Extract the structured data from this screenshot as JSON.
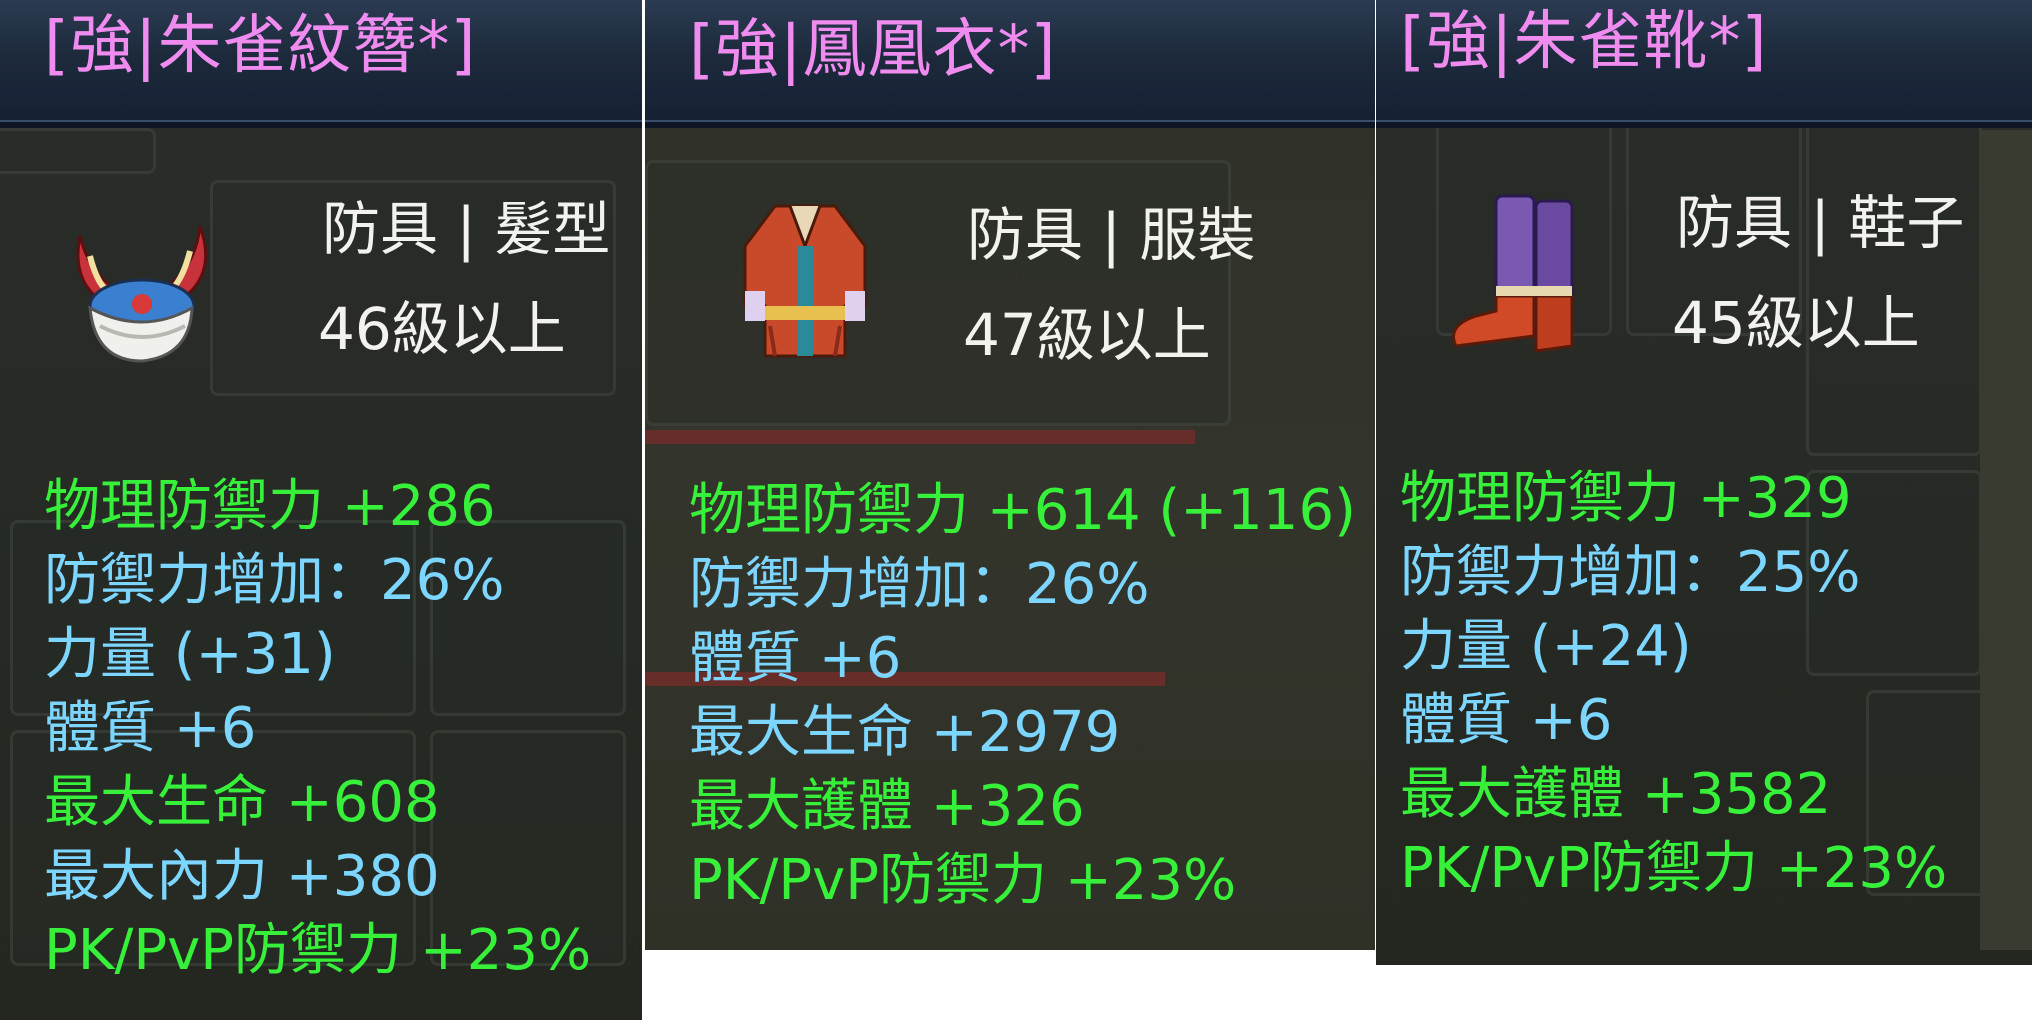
{
  "colors": {
    "title": "#f08cf0",
    "green_stat": "#36f03a",
    "blue_stat": "#7cd6ff",
    "info_text": "#f2f2ee",
    "title_bar": "#1d2a3c"
  },
  "tooltips": [
    {
      "title": "[強|朱雀紋簪*]",
      "icon": "vermilion-horned-helmet-icon",
      "type": "防具 | 髮型",
      "level": "46級以上",
      "stats": [
        {
          "text": "物理防禦力 +286",
          "color": "green"
        },
        {
          "text": "防禦力增加：26%",
          "color": "blue"
        },
        {
          "text": "力量 (+31)",
          "color": "blue"
        },
        {
          "text": "體質 +6",
          "color": "blue"
        },
        {
          "text": "最大生命 +608",
          "color": "green"
        },
        {
          "text": "最大內力 +380",
          "color": "blue"
        },
        {
          "text": "PK/PvP防禦力 +23%",
          "color": "green"
        }
      ]
    },
    {
      "title": "[強|鳳凰衣*]",
      "icon": "phoenix-robe-icon",
      "type": "防具 | 服裝",
      "level": "47級以上",
      "stats": [
        {
          "text": "物理防禦力 +614 (+116)",
          "color": "green"
        },
        {
          "text": "防禦力增加：26%",
          "color": "blue"
        },
        {
          "text": "體質 +6",
          "color": "blue"
        },
        {
          "text": "最大生命 +2979",
          "color": "blue"
        },
        {
          "text": "最大護體 +326",
          "color": "green"
        },
        {
          "text": "PK/PvP防禦力 +23%",
          "color": "green"
        }
      ]
    },
    {
      "title": "[強|朱雀靴*]",
      "icon": "vermilion-boots-icon",
      "type": "防具 | 鞋子",
      "level": "45級以上",
      "stats": [
        {
          "text": "物理防禦力 +329",
          "color": "green"
        },
        {
          "text": "防禦力增加：25%",
          "color": "blue"
        },
        {
          "text": "力量 (+24)",
          "color": "blue"
        },
        {
          "text": "體質 +6",
          "color": "blue"
        },
        {
          "text": "最大護體 +3582",
          "color": "green"
        },
        {
          "text": "PK/PvP防禦力 +23%",
          "color": "green"
        }
      ]
    }
  ]
}
